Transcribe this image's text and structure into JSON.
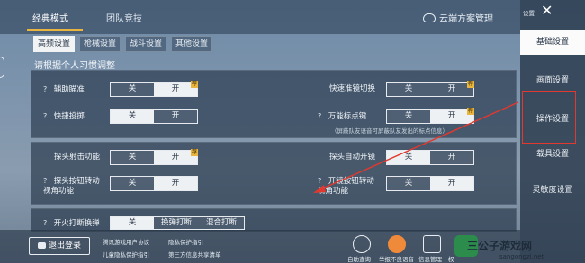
{
  "header": {
    "tabs": [
      {
        "label": "经典模式"
      },
      {
        "label": "团队竞技"
      }
    ],
    "cloud_label": "云端方案管理"
  },
  "subtabs": [
    {
      "label": "高频设置"
    },
    {
      "label": "枪械设置"
    },
    {
      "label": "战斗设置"
    },
    {
      "label": "其他设置"
    }
  ],
  "section_title": "请根据个人习惯调整",
  "rows": {
    "r1": {
      "label": "辅助瞄准",
      "off": "关",
      "on": "开",
      "badge": "荐"
    },
    "r2": {
      "label": "快速准镜切换",
      "off": "关",
      "on": "开",
      "badge": "荐"
    },
    "r3": {
      "label": "快捷投掷",
      "off": "关",
      "on": "开"
    },
    "r4": {
      "label": "万能标点键",
      "off": "关",
      "on": "开",
      "badge": "荐",
      "note": "（屏蔽队友语音可屏蔽队友发出的标点信息）"
    },
    "r5": {
      "label": "探头射击功能",
      "off": "关",
      "on": "开",
      "badge": "荐"
    },
    "r6": {
      "label": "探头自动开镜",
      "off": "关",
      "on": "开"
    },
    "r7": {
      "label": "探头按钮转动视角功能",
      "off": "关",
      "on": "开"
    },
    "r8": {
      "label": "开镜按钮转动视角功能",
      "off": "关",
      "on": "开"
    },
    "r9": {
      "label": "开火打断换弹",
      "opt1": "关",
      "opt2": "换弹打断",
      "opt3": "混合打断"
    }
  },
  "sidebar": {
    "settings_label": "设置",
    "close": "✕",
    "items": [
      {
        "label": "基础设置"
      },
      {
        "label": "画面设置"
      },
      {
        "label": "操作设置"
      },
      {
        "label": "载具设置"
      },
      {
        "label": "灵敏度设置"
      }
    ]
  },
  "footer": {
    "logout": "退出登录",
    "links": [
      "腾讯游戏用户协议",
      "隐私保护指引",
      "儿童隐私保护指引",
      "第三方信息共享清单"
    ],
    "icons": [
      {
        "name": "search-icon",
        "label": "自助查询"
      },
      {
        "name": "warning-icon",
        "label": "举报不良语音"
      },
      {
        "name": "info-icon",
        "label": "信息管理"
      },
      {
        "name": "box-icon",
        "label": "权"
      }
    ]
  },
  "watermark": {
    "text": "三公子游戏网",
    "url": "sangongzi.net"
  },
  "colors": {
    "accent": "#e9b53e",
    "highlight": "#e2382e",
    "active_bg": "#eef1f4"
  }
}
